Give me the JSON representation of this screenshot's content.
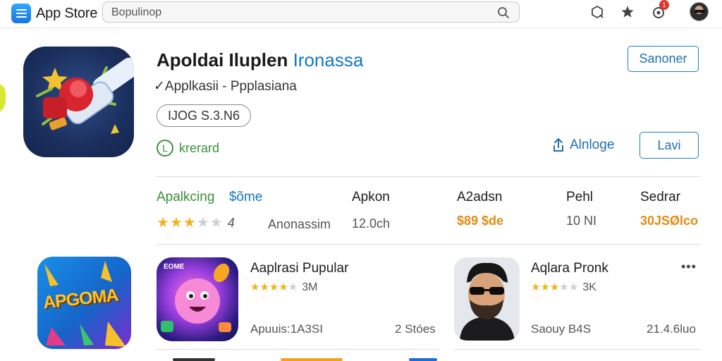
{
  "header": {
    "brand": "App Store",
    "search_value": "Bopulinop",
    "notification_count": "1"
  },
  "hero": {
    "title_main": "Apoldai Iluplen",
    "title_accent": "Ironassa",
    "subtitle": "✓Applkasii  -  Ppplasiana",
    "version": "IJOG S.3.N6",
    "install_label": "krerard",
    "primary_button": "Sanoner",
    "share_label": "Alnloge",
    "secondary_button": "Lavi"
  },
  "stats": {
    "col1_label": "Apalkcing",
    "col1_accent": "$õme",
    "rating_value": "4",
    "rating_stars": 3,
    "col1_sub": "Anonassim",
    "col2_label": "Apkon",
    "col2_value": "12.0ch",
    "col3_label": "A2adsn",
    "col3_value": "$89 $de",
    "col4_label": "Pehl",
    "col4_value": "10 NI",
    "col5_label": "Sedrar",
    "col5_value": "30JSØlco"
  },
  "apps": [
    {
      "badge": "APGOMA",
      "icon_kind": "logo"
    },
    {
      "name": "Aaplrasi Pupular",
      "stars": 4,
      "count": "3M",
      "meta": "Apuuis:1A3SI",
      "size": "2 Stóes",
      "icon_text": "EOME"
    },
    {
      "name": "Aqlara Pronk",
      "stars": 3,
      "count": "3K",
      "meta": "Saouy  B4S",
      "size": "21.4.6luo"
    }
  ],
  "colors": {
    "accent_blue": "#1476c9",
    "install_green": "#3c8f3a",
    "price_orange": "#e58a12",
    "star_gold": "#f1b31c"
  }
}
